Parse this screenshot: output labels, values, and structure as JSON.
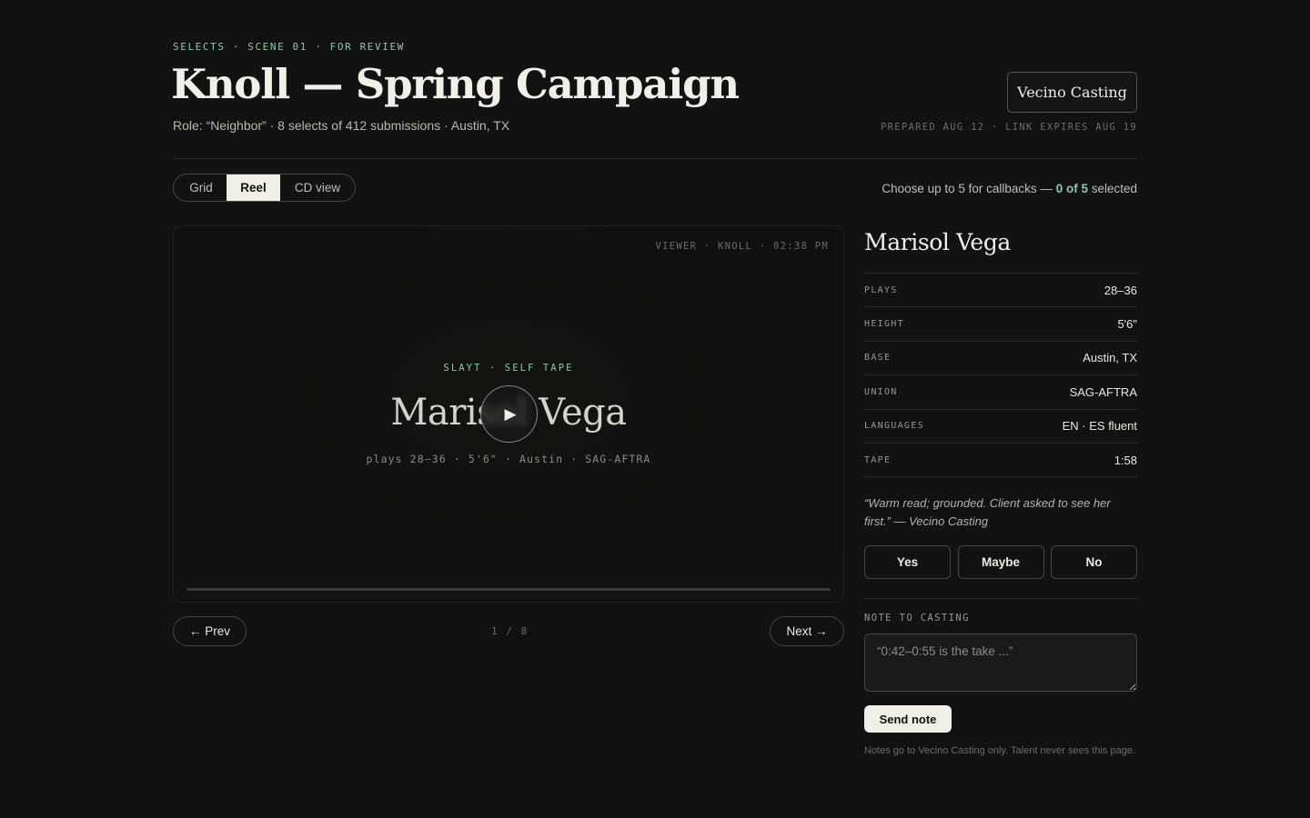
{
  "header": {
    "eyebrow": "SELECTS · SCENE 01 · FOR REVIEW",
    "title": "Knoll — Spring Campaign",
    "subtitle": "Role: “Neighbor” · 8 selects of 412 submissions · Austin, TX",
    "agency": "Vecino Casting",
    "prepared": "PREPARED AUG 12 · LINK EXPIRES AUG 19"
  },
  "view_tabs": [
    {
      "label": "Grid",
      "active": false
    },
    {
      "label": "Reel",
      "active": true
    },
    {
      "label": "CD view",
      "active": false
    }
  ],
  "callbacks": {
    "prefix": "Choose up to 5 for callbacks — ",
    "count": "0 of 5",
    "suffix": " selected"
  },
  "player": {
    "viewer": "VIEWER · KNOLL · 02:38 PM",
    "slate": "SLAYT · SELF TAPE",
    "name": "Marisol Vega",
    "specs": "plays 28–36 · 5'6\" · Austin · SAG-AFTRA",
    "play_icon": "▶"
  },
  "nav": {
    "prev": "← Prev",
    "next": "Next →",
    "counter": "1 / 8"
  },
  "talent": {
    "name": "Marisol Vega",
    "attributes": [
      {
        "label": "PLAYS",
        "value": "28–36"
      },
      {
        "label": "HEIGHT",
        "value": "5'6\""
      },
      {
        "label": "BASE",
        "value": "Austin, TX"
      },
      {
        "label": "UNION",
        "value": "SAG-AFTRA"
      },
      {
        "label": "LANGUAGES",
        "value": "EN · ES fluent"
      },
      {
        "label": "TAPE",
        "value": "1:58"
      }
    ],
    "quote": "“Warm read; grounded. Client asked to see her first.” — Vecino Casting",
    "votes": [
      "Yes",
      "Maybe",
      "No"
    ]
  },
  "note": {
    "label": "NOTE TO CASTING",
    "placeholder": "“0:42–0:55 is the take ...”",
    "send_label": "Send note",
    "disclaimer": "Notes go to Vecino Casting only. Talent never sees this page."
  },
  "colors": {
    "background": "#121212",
    "accent": "#8fc7a6",
    "text": "#e9e6df",
    "border": "#48463f"
  }
}
